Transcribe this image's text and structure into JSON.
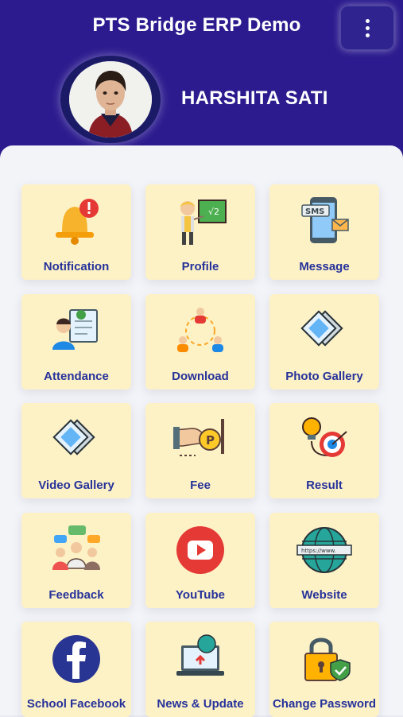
{
  "header": {
    "title": "PTS Bridge ERP Demo",
    "menu_icon": "more-vertical-icon"
  },
  "user": {
    "name": "HARSHITA SATI"
  },
  "colors": {
    "header_bg": "#2b1b8e",
    "tile_bg": "#fdf1c6",
    "tile_label": "#26329a"
  },
  "tiles": [
    {
      "label": "Notification",
      "icon": "bell-alert-icon"
    },
    {
      "label": "Profile",
      "icon": "teacher-board-icon"
    },
    {
      "label": "Message",
      "icon": "sms-phone-icon"
    },
    {
      "label": "Attendance",
      "icon": "attendance-clipboard-icon"
    },
    {
      "label": "Download",
      "icon": "people-exchange-icon"
    },
    {
      "label": "Photo Gallery",
      "icon": "photos-icon"
    },
    {
      "label": "Video Gallery",
      "icon": "video-photos-icon"
    },
    {
      "label": "Fee",
      "icon": "coin-hand-icon"
    },
    {
      "label": "Result",
      "icon": "target-bulb-icon"
    },
    {
      "label": "Feedback",
      "icon": "feedback-group-icon"
    },
    {
      "label": "YouTube",
      "icon": "youtube-icon"
    },
    {
      "label": "Website",
      "icon": "globe-web-icon"
    },
    {
      "label": "School Facebook",
      "icon": "facebook-icon"
    },
    {
      "label": "News & Update",
      "icon": "laptop-globe-icon"
    },
    {
      "label": "Change Password",
      "icon": "padlock-shield-icon"
    }
  ]
}
